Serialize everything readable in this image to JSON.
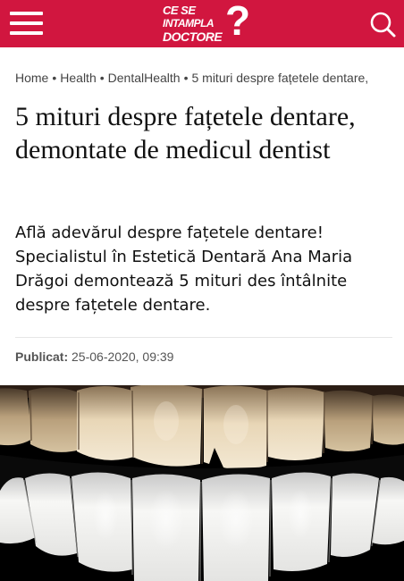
{
  "header": {
    "logo_line1": "CE SE",
    "logo_line2": "INTAMPLA",
    "logo_line3": "DOCTORE",
    "logo_mark": "?",
    "menu_icon": "hamburger-menu-icon",
    "search_icon": "search-icon",
    "background_color": "#d1163f"
  },
  "breadcrumb": {
    "items": [
      "Home",
      "Health",
      "DentalHealth",
      "5 mituri despre fațetele dentare,"
    ],
    "separator": "•"
  },
  "article": {
    "title": "5 mituri despre fațetele dentare, demontate de medicul dentist",
    "lead": "Află adevărul despre fațetele dentare! Specialistul în Estetică Dentară Ana Maria Drăgoi demontează 5 mituri des întâlnite despre fațetele dentare.",
    "published_label": "Publicat:",
    "published_value": "25-06-2020, 09:39"
  }
}
